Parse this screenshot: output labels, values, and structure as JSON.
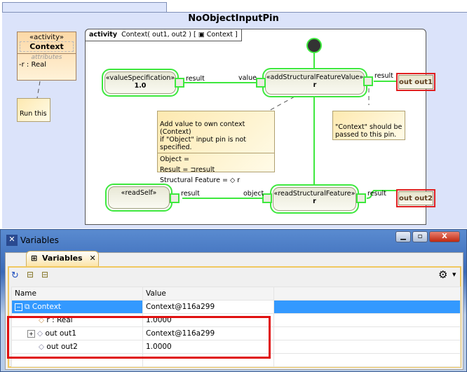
{
  "diagram": {
    "title": "NoObjectInputPin",
    "frame": {
      "kind": "activity",
      "signature": "Context( out1, out2 ) [",
      "context": "Context ]"
    },
    "class_box": {
      "stereotype": "«activity»",
      "name": "Context",
      "section": "attributes",
      "attribute": "-r : Real"
    },
    "note_run": "Run this",
    "value_spec": {
      "stereotype": "«valueSpecification»",
      "value": "1.0",
      "pin": "result"
    },
    "add_sfv": {
      "stereotype": "«addStructuralFeatureValue»",
      "feature": "r",
      "in_pin": "value",
      "out_pin": "result"
    },
    "read_self": {
      "stereotype": "«readSelf»",
      "pin": "result"
    },
    "read_sf": {
      "stereotype": "«readStructuralFeature»",
      "feature": "r",
      "in_pin": "object",
      "out_pin": "result"
    },
    "out1": "out out1",
    "out2": "out out2",
    "note_add": {
      "line1": "Add value to own context (Context)",
      "line2": "if \"Object\" input pin is not specified.",
      "object": "Object =",
      "result": "Result =",
      "result_val": "result",
      "feature": "Structural Feature =",
      "feature_val": "r"
    },
    "note_context": {
      "line1": "\"Context\" should be",
      "line2": "passed to this pin."
    },
    "colors": {
      "flow": "#3ee83e",
      "highlight": "#e01010"
    }
  },
  "window": {
    "title": "Variables",
    "tab": "Variables",
    "columns": [
      "Name",
      "Value"
    ],
    "rows": [
      {
        "name": "Context",
        "value": "Context@116a299",
        "selected": true
      },
      {
        "name": "r : Real",
        "value": "1.0000"
      },
      {
        "name": "out out1",
        "value": "Context@116a299"
      },
      {
        "name": "out out2",
        "value": "1.0000"
      }
    ]
  }
}
